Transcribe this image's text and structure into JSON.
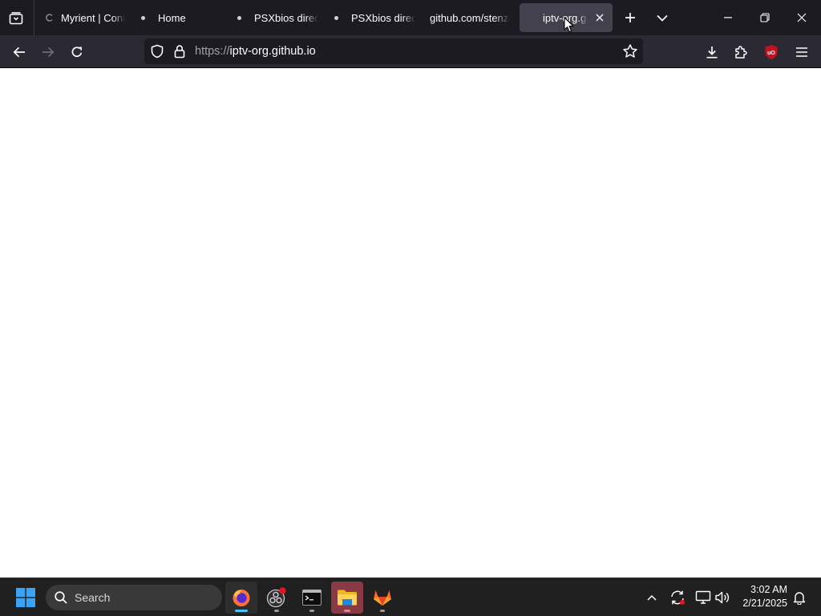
{
  "browser": {
    "tabs": [
      {
        "title": "Myrient | Cont",
        "favicon": "loading-icon",
        "active": false
      },
      {
        "title": "Home",
        "favicon": "dot-icon",
        "active": false
      },
      {
        "title": "PSXbios direct",
        "favicon": "dot-icon",
        "active": false
      },
      {
        "title": "PSXbios direct",
        "favicon": "dot-icon",
        "active": false
      },
      {
        "title": "github.com/stenze",
        "favicon": "none",
        "active": false
      },
      {
        "title": "iptv-org.g",
        "favicon": "none",
        "active": true
      }
    ],
    "url": {
      "scheme": "https://",
      "host": "iptv-org.github.io"
    },
    "colors": {
      "tabstrip_bg": "#1c1b22",
      "toolbar_bg": "#2b2a33",
      "active_tab_bg": "#42414d",
      "urlbar_bg": "#1c1b22",
      "ublock_red": "#c1121f"
    },
    "toolbar_icons": [
      "tab-list-icon",
      "new-tab-icon",
      "all-tabs-chevron-icon",
      "back-arrow-icon",
      "forward-arrow-icon",
      "reload-icon",
      "shield-icon",
      "lock-icon",
      "star-icon",
      "download-icon",
      "extensions-puzzle-icon",
      "ublock-origin-icon",
      "hamburger-menu-icon"
    ]
  },
  "content": {
    "background": "#ffffff"
  },
  "taskbar": {
    "search_label": "Search",
    "apps": [
      "firefox-icon",
      "obs-studio-icon",
      "terminal-icon",
      "file-explorer-icon",
      "gitlab-icon"
    ],
    "clock": {
      "time": "3:02 AM",
      "date": "2/21/2025"
    },
    "accent": "#4cc2ff"
  }
}
